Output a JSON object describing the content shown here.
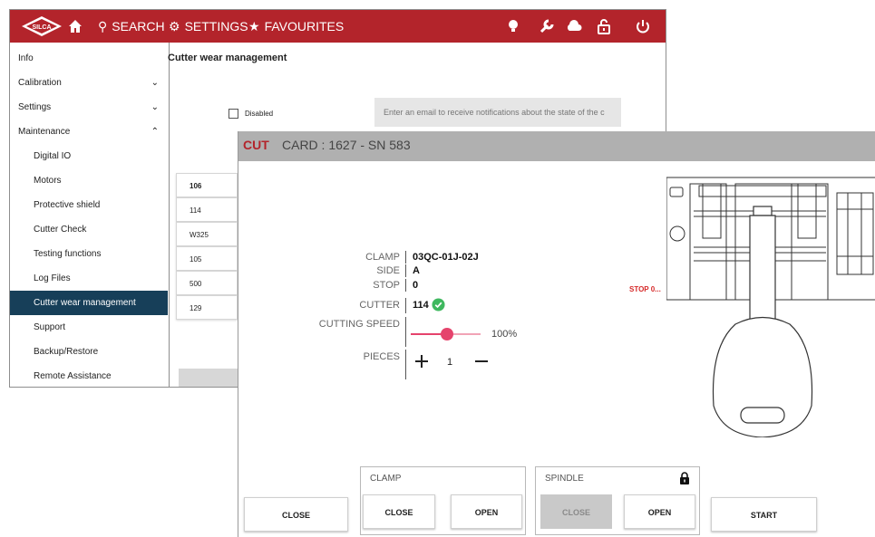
{
  "topbar": {
    "brand_color": "#b3242b",
    "logo_text": "SILCA",
    "home_icon": "home-icon",
    "search_label": "SEARCH",
    "settings_label": "SETTINGS",
    "favourites_label": "FAVOURITES",
    "right_icons": [
      "lightbulb-icon",
      "wrench-icon",
      "cloud-icon",
      "unlock-icon",
      "power-icon"
    ]
  },
  "sidebar": {
    "active_color": "#173f59",
    "items": [
      {
        "label": "Info"
      },
      {
        "label": "Calibration",
        "chevron": "⌄"
      },
      {
        "label": "Settings",
        "chevron": "⌄"
      },
      {
        "label": "Maintenance",
        "chevron": "⌃"
      },
      {
        "label": "Digital IO"
      },
      {
        "label": "Motors"
      },
      {
        "label": "Protective shield"
      },
      {
        "label": "Cutter Check"
      },
      {
        "label": "Testing functions"
      },
      {
        "label": "Log Files"
      },
      {
        "label": "Cutter wear management"
      },
      {
        "label": "Support"
      },
      {
        "label": "Backup/Restore"
      },
      {
        "label": "Remote Assistance"
      }
    ]
  },
  "cutter_wear": {
    "title": "Cutter wear management",
    "disabled_label": "Disabled",
    "email_placeholder": "Enter an email to receive notifications about the state of the c",
    "cutters": [
      "106",
      "114",
      "W325",
      "105",
      "500",
      "129"
    ]
  },
  "cut_dialog": {
    "cut_label": "CUT",
    "card_label": "CARD : 1627 - SN 583",
    "clamp_label": "CLAMP",
    "clamp_value": "03QC-01J-02J",
    "side_label": "SIDE",
    "side_value": "A",
    "stop_label": "STOP",
    "stop_value": "0",
    "cutter_label": "CUTTER",
    "cutter_value": "114",
    "cutting_speed_label": "CUTTING SPEED",
    "cutting_speed_value": "100%",
    "pieces_label": "PIECES",
    "pieces_value": "1",
    "stop_marker": "STOP 0...",
    "close_label": "CLOSE",
    "clamp_group_title": "CLAMP",
    "clamp_close_label": "CLOSE",
    "clamp_open_label": "OPEN",
    "spindle_group_title": "SPINDLE",
    "spindle_close_label": "CLOSE",
    "spindle_open_label": "OPEN",
    "start_label": "START",
    "accent_pink": "#e5436c",
    "check_green": "#3fb85f"
  }
}
